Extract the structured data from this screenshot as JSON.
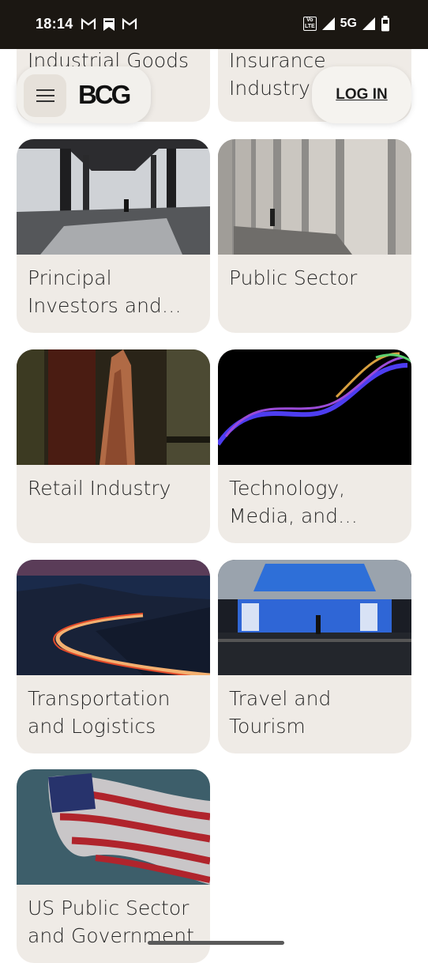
{
  "status_bar": {
    "time": "18:14",
    "notifications": [
      "gmail-icon",
      "bookmark-icon",
      "gmail-icon"
    ],
    "volte": "Vo LTE",
    "network": "5G"
  },
  "header": {
    "logo": "BCG",
    "login_label": "LOG IN"
  },
  "industries": [
    {
      "label": "Industrial Goods"
    },
    {
      "label": "Insurance Industry"
    },
    {
      "label": "Principal Investors and…"
    },
    {
      "label": "Public Sector"
    },
    {
      "label": "Retail Industry"
    },
    {
      "label": "Technology, Media, and…"
    },
    {
      "label": "Transportation and Logistics"
    },
    {
      "label": "Travel and Tourism"
    },
    {
      "label": "US Public Sector and Government"
    }
  ]
}
